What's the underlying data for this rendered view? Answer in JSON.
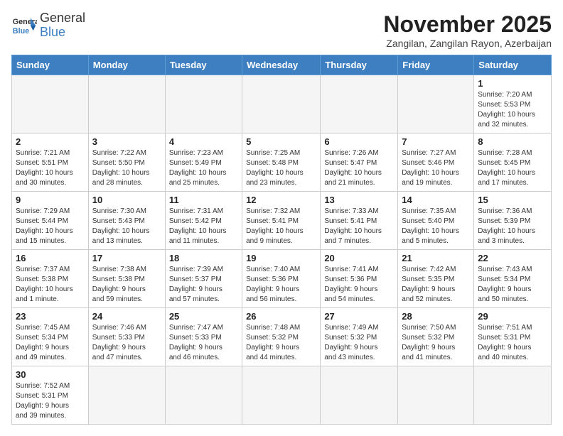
{
  "header": {
    "logo_line1": "General",
    "logo_line2": "Blue",
    "month_title": "November 2025",
    "location": "Zangilan, Zangilan Rayon, Azerbaijan"
  },
  "weekdays": [
    "Sunday",
    "Monday",
    "Tuesday",
    "Wednesday",
    "Thursday",
    "Friday",
    "Saturday"
  ],
  "days": {
    "d1": {
      "num": "1",
      "info": "Sunrise: 7:20 AM\nSunset: 5:53 PM\nDaylight: 10 hours\nand 32 minutes."
    },
    "d2": {
      "num": "2",
      "info": "Sunrise: 7:21 AM\nSunset: 5:51 PM\nDaylight: 10 hours\nand 30 minutes."
    },
    "d3": {
      "num": "3",
      "info": "Sunrise: 7:22 AM\nSunset: 5:50 PM\nDaylight: 10 hours\nand 28 minutes."
    },
    "d4": {
      "num": "4",
      "info": "Sunrise: 7:23 AM\nSunset: 5:49 PM\nDaylight: 10 hours\nand 25 minutes."
    },
    "d5": {
      "num": "5",
      "info": "Sunrise: 7:25 AM\nSunset: 5:48 PM\nDaylight: 10 hours\nand 23 minutes."
    },
    "d6": {
      "num": "6",
      "info": "Sunrise: 7:26 AM\nSunset: 5:47 PM\nDaylight: 10 hours\nand 21 minutes."
    },
    "d7": {
      "num": "7",
      "info": "Sunrise: 7:27 AM\nSunset: 5:46 PM\nDaylight: 10 hours\nand 19 minutes."
    },
    "d8": {
      "num": "8",
      "info": "Sunrise: 7:28 AM\nSunset: 5:45 PM\nDaylight: 10 hours\nand 17 minutes."
    },
    "d9": {
      "num": "9",
      "info": "Sunrise: 7:29 AM\nSunset: 5:44 PM\nDaylight: 10 hours\nand 15 minutes."
    },
    "d10": {
      "num": "10",
      "info": "Sunrise: 7:30 AM\nSunset: 5:43 PM\nDaylight: 10 hours\nand 13 minutes."
    },
    "d11": {
      "num": "11",
      "info": "Sunrise: 7:31 AM\nSunset: 5:42 PM\nDaylight: 10 hours\nand 11 minutes."
    },
    "d12": {
      "num": "12",
      "info": "Sunrise: 7:32 AM\nSunset: 5:41 PM\nDaylight: 10 hours\nand 9 minutes."
    },
    "d13": {
      "num": "13",
      "info": "Sunrise: 7:33 AM\nSunset: 5:41 PM\nDaylight: 10 hours\nand 7 minutes."
    },
    "d14": {
      "num": "14",
      "info": "Sunrise: 7:35 AM\nSunset: 5:40 PM\nDaylight: 10 hours\nand 5 minutes."
    },
    "d15": {
      "num": "15",
      "info": "Sunrise: 7:36 AM\nSunset: 5:39 PM\nDaylight: 10 hours\nand 3 minutes."
    },
    "d16": {
      "num": "16",
      "info": "Sunrise: 7:37 AM\nSunset: 5:38 PM\nDaylight: 10 hours\nand 1 minute."
    },
    "d17": {
      "num": "17",
      "info": "Sunrise: 7:38 AM\nSunset: 5:38 PM\nDaylight: 9 hours\nand 59 minutes."
    },
    "d18": {
      "num": "18",
      "info": "Sunrise: 7:39 AM\nSunset: 5:37 PM\nDaylight: 9 hours\nand 57 minutes."
    },
    "d19": {
      "num": "19",
      "info": "Sunrise: 7:40 AM\nSunset: 5:36 PM\nDaylight: 9 hours\nand 56 minutes."
    },
    "d20": {
      "num": "20",
      "info": "Sunrise: 7:41 AM\nSunset: 5:36 PM\nDaylight: 9 hours\nand 54 minutes."
    },
    "d21": {
      "num": "21",
      "info": "Sunrise: 7:42 AM\nSunset: 5:35 PM\nDaylight: 9 hours\nand 52 minutes."
    },
    "d22": {
      "num": "22",
      "info": "Sunrise: 7:43 AM\nSunset: 5:34 PM\nDaylight: 9 hours\nand 50 minutes."
    },
    "d23": {
      "num": "23",
      "info": "Sunrise: 7:45 AM\nSunset: 5:34 PM\nDaylight: 9 hours\nand 49 minutes."
    },
    "d24": {
      "num": "24",
      "info": "Sunrise: 7:46 AM\nSunset: 5:33 PM\nDaylight: 9 hours\nand 47 minutes."
    },
    "d25": {
      "num": "25",
      "info": "Sunrise: 7:47 AM\nSunset: 5:33 PM\nDaylight: 9 hours\nand 46 minutes."
    },
    "d26": {
      "num": "26",
      "info": "Sunrise: 7:48 AM\nSunset: 5:32 PM\nDaylight: 9 hours\nand 44 minutes."
    },
    "d27": {
      "num": "27",
      "info": "Sunrise: 7:49 AM\nSunset: 5:32 PM\nDaylight: 9 hours\nand 43 minutes."
    },
    "d28": {
      "num": "28",
      "info": "Sunrise: 7:50 AM\nSunset: 5:32 PM\nDaylight: 9 hours\nand 41 minutes."
    },
    "d29": {
      "num": "29",
      "info": "Sunrise: 7:51 AM\nSunset: 5:31 PM\nDaylight: 9 hours\nand 40 minutes."
    },
    "d30": {
      "num": "30",
      "info": "Sunrise: 7:52 AM\nSunset: 5:31 PM\nDaylight: 9 hours\nand 39 minutes."
    }
  }
}
